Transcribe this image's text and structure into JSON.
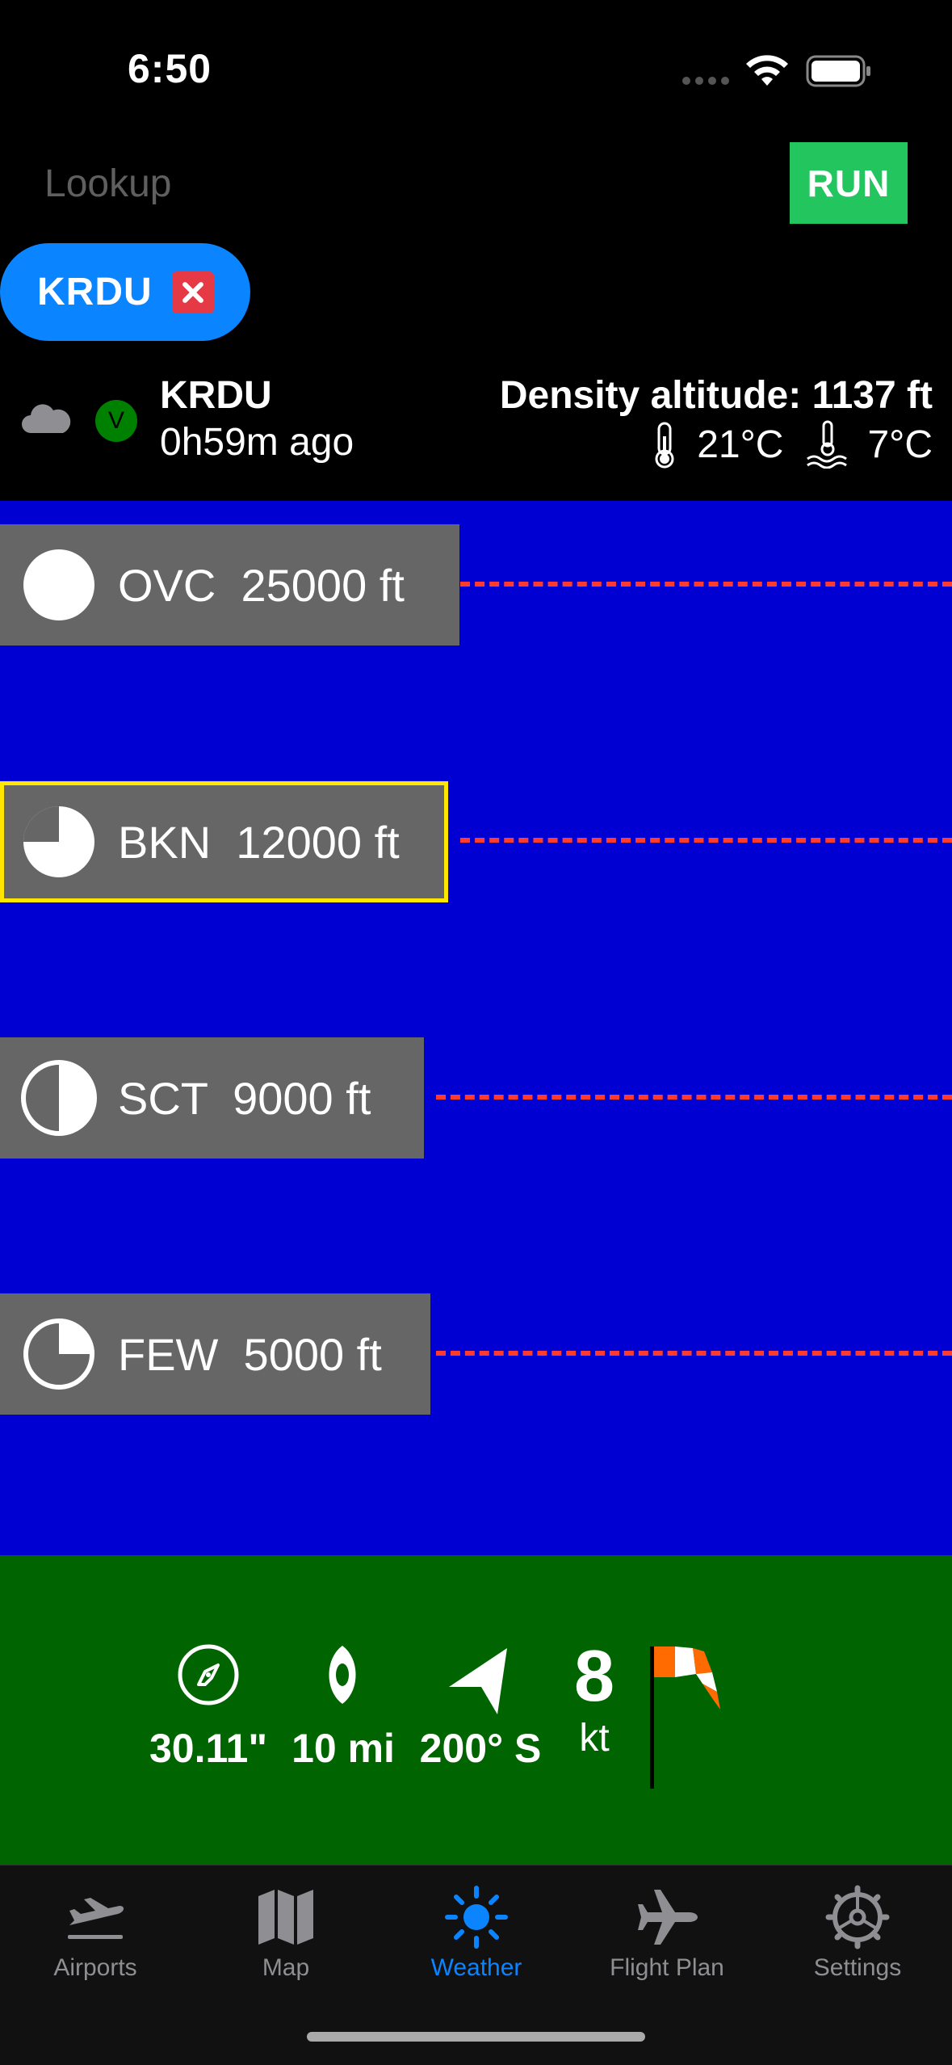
{
  "status_bar": {
    "time": "6:50"
  },
  "header": {
    "lookup_placeholder": "Lookup",
    "run_label": "RUN",
    "chip_label": "KRDU"
  },
  "station": {
    "id": "KRDU",
    "age": "0h59m ago",
    "flight_category": "V",
    "density_altitude": "Density altitude: 1137 ft",
    "temperature": "21°C",
    "dewpoint": "7°C"
  },
  "cloud_layers": [
    {
      "cover": "OVC",
      "altitude": "25000 ft",
      "coverage": 1.0
    },
    {
      "cover": "BKN",
      "altitude": "12000 ft",
      "coverage": 0.75,
      "selected": true
    },
    {
      "cover": "SCT",
      "altitude": "9000 ft",
      "coverage": 0.5
    },
    {
      "cover": "FEW",
      "altitude": "5000 ft",
      "coverage": 0.25
    }
  ],
  "wind": {
    "altimeter": "30.11\"",
    "visibility": "10 mi",
    "direction": "200° S",
    "speed": "8",
    "speed_unit": "kt"
  },
  "tabs": [
    {
      "label": "Airports",
      "icon": "airplane-departure-icon",
      "active": false
    },
    {
      "label": "Map",
      "icon": "map-icon",
      "active": false
    },
    {
      "label": "Weather",
      "icon": "sun-icon",
      "active": true
    },
    {
      "label": "Flight Plan",
      "icon": "airplane-icon",
      "active": false
    },
    {
      "label": "Settings",
      "icon": "gear-icon",
      "active": false
    }
  ],
  "colors": {
    "sky": "#0000d2",
    "wind_panel": "#006400",
    "accent": "#0a84ff",
    "run": "#22c55e",
    "layer_line": "#ff3b30",
    "highlight": "#ffe600"
  }
}
